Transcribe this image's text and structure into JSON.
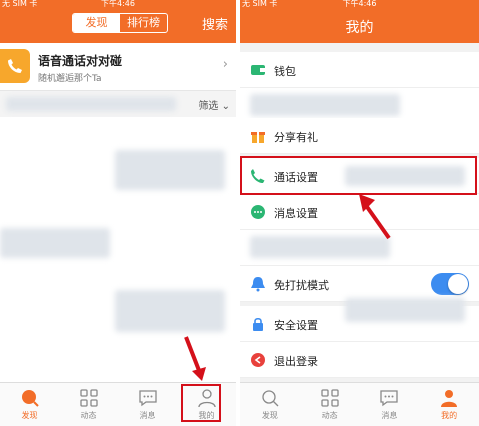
{
  "left": {
    "status": {
      "carrier": "无 SIM 卡",
      "time": "下午4:46"
    },
    "nav": {
      "tab_discover": "发现",
      "tab_rank": "排行榜",
      "search": "搜索"
    },
    "card": {
      "title": "语音通话对对碰",
      "subtitle": "随机邂逅那个Ta"
    },
    "filter": "筛选",
    "tabs": [
      "发现",
      "动态",
      "消息",
      "我的"
    ]
  },
  "right": {
    "status": {
      "carrier": "无 SIM 卡",
      "time": "下午4:46"
    },
    "title": "我的",
    "menu": {
      "wallet": "钱包",
      "share": "分享有礼",
      "call_settings": "通话设置",
      "msg_settings": "消息设置",
      "dnd": "免打扰模式",
      "security": "安全设置",
      "logout": "退出登录"
    },
    "dnd_enabled": true,
    "tabs": [
      "发现",
      "动态",
      "消息",
      "我的"
    ]
  },
  "colors": {
    "accent": "#f26d28",
    "highlight": "#d4101a",
    "toggle": "#3c8cf0"
  }
}
